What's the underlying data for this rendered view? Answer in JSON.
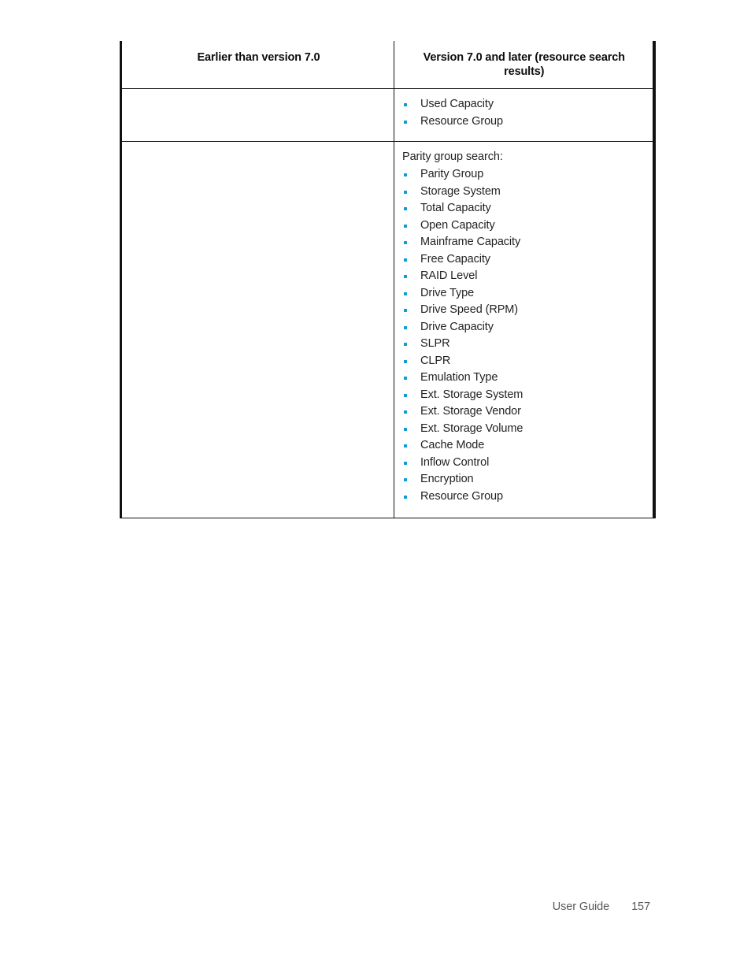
{
  "document": {
    "page_number": "157",
    "footer_label": "User Guide",
    "bullet_color": "#0e9bd6",
    "text_color": "#231f20",
    "rule_color": "#111111"
  },
  "table": {
    "columns": [
      {
        "header": "Earlier than version 7.0"
      },
      {
        "header": "Version 7.0 and later (resource search results)"
      }
    ],
    "rows": [
      {
        "left": {
          "intro": "",
          "bullets": []
        },
        "right": {
          "intro": "",
          "bullets": [
            "Used Capacity",
            "Resource Group"
          ]
        }
      },
      {
        "left": {
          "intro": "",
          "bullets": []
        },
        "right": {
          "intro": "Parity group search:",
          "bullets": [
            "Parity Group",
            "Storage System",
            "Total Capacity",
            "Open Capacity",
            "Mainframe Capacity",
            "Free Capacity",
            "RAID Level",
            "Drive Type",
            "Drive Speed (RPM)",
            "Drive Capacity",
            "SLPR",
            "CLPR",
            "Emulation Type",
            "Ext. Storage System",
            "Ext. Storage Vendor",
            "Ext. Storage Volume",
            "Cache Mode",
            "Inflow Control",
            "Encryption",
            "Resource Group"
          ]
        }
      }
    ]
  }
}
